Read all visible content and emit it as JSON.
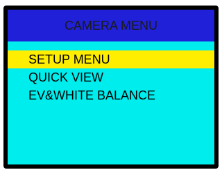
{
  "menu": {
    "title": "CAMERA MENU",
    "items": [
      {
        "label": "SETUP MENU",
        "selected": true
      },
      {
        "label": "QUICK VIEW",
        "selected": false
      },
      {
        "label": "EV&WHITE BALANCE",
        "selected": false
      }
    ]
  },
  "colors": {
    "header_bg": "#2020d8",
    "body_bg": "#00eded",
    "highlight": "#ffee00",
    "border": "#000000"
  }
}
